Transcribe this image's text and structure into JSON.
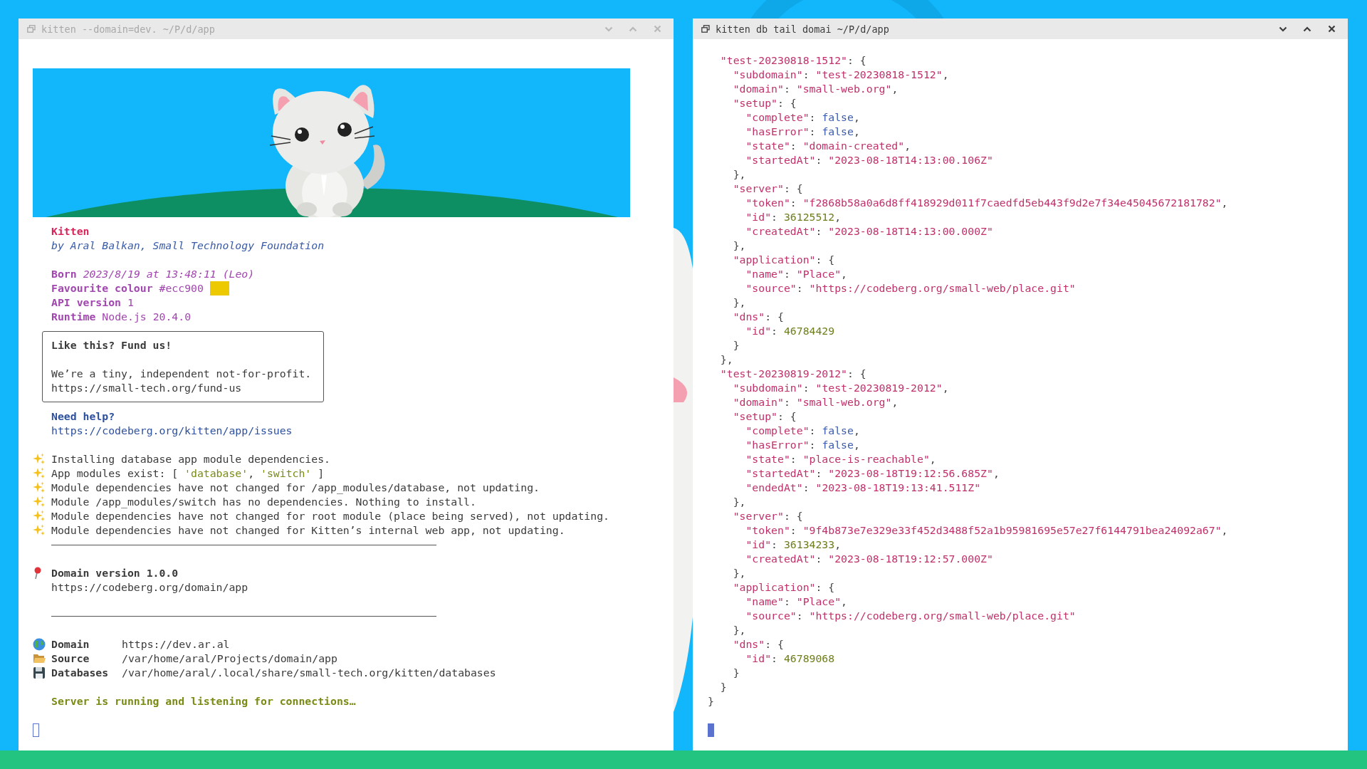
{
  "windows": [
    {
      "kind": "console",
      "title": "kitten --domain=dev. ~/P/d/app",
      "focused": false,
      "app": {
        "name": "Kitten",
        "byline": "by Aral Balkan, Small Technology Foundation"
      },
      "facts": [
        {
          "label": "Born",
          "value": "2023/8/19 at 13:48:11 (Leo)",
          "kind": "date"
        },
        {
          "label": "Favourite colour",
          "value": "#ecc900",
          "kind": "color",
          "color": "#ecc900"
        },
        {
          "label": "API version",
          "value": "1",
          "kind": "text"
        },
        {
          "label": "Runtime",
          "value": "Node.js 20.4.0",
          "kind": "text"
        }
      ],
      "fund_box": {
        "title": "Like this? Fund us!",
        "text": "We’re a tiny, independent not-for-profit.",
        "link": "https://small-tech.org/fund-us"
      },
      "help": {
        "title": "Need help?",
        "link": "https://codeberg.org/kitten/app/issues"
      },
      "log": [
        "Installing database app module dependencies.",
        "App modules exist: [ 'database', 'switch' ]",
        "Module dependencies have not changed for /app_modules/database, not updating.",
        "Module /app_modules/switch has no dependencies. Nothing to install.",
        "Module dependencies have not changed for root module (place being served), not updating.",
        "Module dependencies have not changed for Kitten’s internal web app, not updating."
      ],
      "domain": {
        "title": "Domain version 1.0.0",
        "link": "https://codeberg.org/domain/app"
      },
      "paths": [
        {
          "kind": "globe",
          "label": "Domain",
          "value": "https://dev.ar.al"
        },
        {
          "kind": "folder",
          "label": "Source",
          "value": "/var/home/aral/Projects/domain/app"
        },
        {
          "kind": "disk",
          "label": "Databases",
          "value": "/var/home/aral/.local/share/small-tech.org/kitten/databases"
        }
      ],
      "status": "Server is running and listening for connections…"
    },
    {
      "kind": "json",
      "title": "kitten db tail domai ~/P/d/app",
      "focused": true,
      "lines": [
        "  \"test-20230818-1512\": {",
        "    \"subdomain\": \"test-20230818-1512\",",
        "    \"domain\": \"small-web.org\",",
        "    \"setup\": {",
        "      \"complete\": false,",
        "      \"hasError\": false,",
        "      \"state\": \"domain-created\",",
        "      \"startedAt\": \"2023-08-18T14:13:00.106Z\"",
        "    },",
        "    \"server\": {",
        "      \"token\": \"f2868b58a0a6d8ff418929d011f7caedfd5eb443f9d2e7f34e45045672181782\",",
        "      \"id\": 36125512,",
        "      \"createdAt\": \"2023-08-18T14:13:00.000Z\"",
        "    },",
        "    \"application\": {",
        "      \"name\": \"Place\",",
        "      \"source\": \"https://codeberg.org/small-web/place.git\"",
        "    },",
        "    \"dns\": {",
        "      \"id\": 46784429",
        "    }",
        "  },",
        "  \"test-20230819-2012\": {",
        "    \"subdomain\": \"test-20230819-2012\",",
        "    \"domain\": \"small-web.org\",",
        "    \"setup\": {",
        "      \"complete\": false,",
        "      \"hasError\": false,",
        "      \"state\": \"place-is-reachable\",",
        "      \"startedAt\": \"2023-08-18T19:12:56.685Z\",",
        "      \"endedAt\": \"2023-08-18T19:13:41.511Z\"",
        "    },",
        "    \"server\": {",
        "      \"token\": \"9f4b873e7e329e33f452d3488f52a1b95981695e57e27f6144791bea24092a67\",",
        "      \"id\": 36134233,",
        "      \"createdAt\": \"2023-08-18T19:12:57.000Z\"",
        "    },",
        "    \"application\": {",
        "      \"name\": \"Place\",",
        "      \"source\": \"https://codeberg.org/small-web/place.git\"",
        "    },",
        "    \"dns\": {",
        "      \"id\": 46789068",
        "    }",
        "  }",
        "}"
      ]
    }
  ]
}
